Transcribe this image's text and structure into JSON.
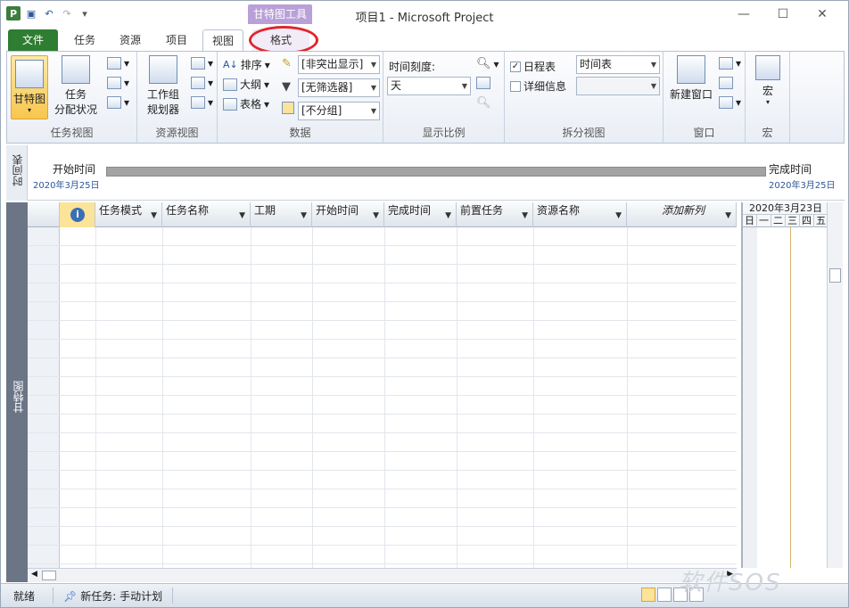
{
  "app": {
    "title": "项目1 - Microsoft Project",
    "context_tab_header": "甘特图工具"
  },
  "tabs": {
    "file": "文件",
    "task": "任务",
    "resource": "资源",
    "project": "项目",
    "view": "视图",
    "format": "格式"
  },
  "ribbon": {
    "task_views": {
      "label": "任务视图",
      "gantt": "甘特图",
      "task_usage_1": "任务",
      "task_usage_2": "分配状况"
    },
    "resource_views": {
      "label": "资源视图",
      "team_planner_1": "工作组",
      "team_planner_2": "规划器"
    },
    "data": {
      "label": "数据",
      "sort": "排序",
      "outline": "大纲",
      "tables": "表格",
      "highlight": "[非突出显示]",
      "filter": "[无筛选器]",
      "group": "[不分组]"
    },
    "zoom": {
      "label": "显示比例",
      "timescale_label": "时间刻度:",
      "timescale_value": "天"
    },
    "split_view": {
      "label": "拆分视图",
      "timeline_check": "日程表",
      "details_check": "详细信息",
      "timeline_value": "时间表",
      "timeline_checked": true,
      "details_checked": false
    },
    "window": {
      "label": "窗口",
      "new_window": "新建窗口"
    },
    "macros": {
      "label": "宏",
      "macros_btn": "宏"
    }
  },
  "timeline": {
    "side_label": "时间表",
    "start_label": "开始时间",
    "start_date": "2020年3月25日",
    "end_label": "完成时间",
    "end_date": "2020年3月25日"
  },
  "grid": {
    "side_label": "甘特图",
    "columns": [
      "任务模式",
      "任务名称",
      "工期",
      "开始时间",
      "完成时间",
      "前置任务",
      "资源名称",
      "添加新列"
    ]
  },
  "chart": {
    "header": "2020年3月23日",
    "days": [
      "日",
      "一",
      "二",
      "三",
      "四",
      "五"
    ]
  },
  "status": {
    "ready": "就绪",
    "new_tasks": "新任务: 手动计划"
  },
  "watermark": "软件SOS"
}
